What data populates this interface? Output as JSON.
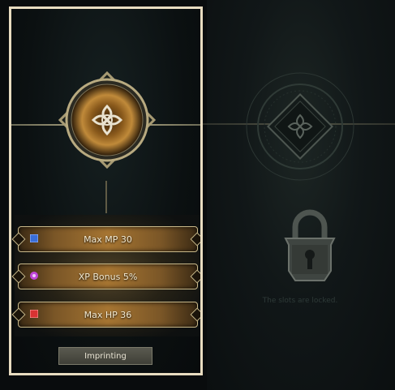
{
  "slots": [
    {
      "label": "Max MP 30",
      "gem_color": "#3a6ed8",
      "icon": "blue-square-gem-icon"
    },
    {
      "label": "XP Bonus 5%",
      "gem_color": "#c046d8",
      "icon": "purple-round-gem-icon"
    },
    {
      "label": "Max HP 36",
      "gem_color": "#d83232",
      "icon": "red-square-gem-icon"
    }
  ],
  "imprint_button": {
    "label": "Imprinting"
  },
  "locked": {
    "message": "The slots are locked.",
    "icon": "padlock-icon"
  },
  "colors": {
    "frame": "#e8dcc0",
    "gold": "#c9b98a"
  }
}
